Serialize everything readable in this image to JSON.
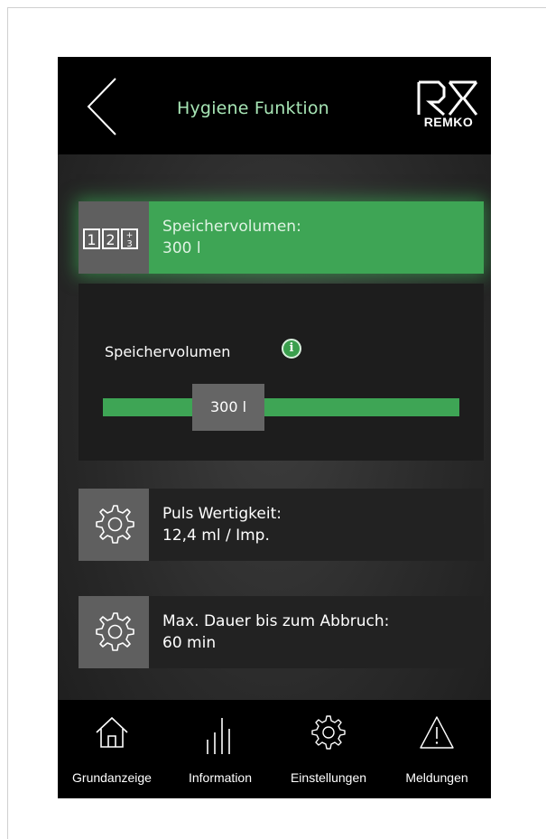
{
  "header": {
    "title": "Hygiene Funktion",
    "back_icon": "chevron-left-icon",
    "logo_text": "REMKO"
  },
  "cards": [
    {
      "label": "Speichervolumen:",
      "value": "300 l",
      "icon": "numeric-keypad-icon",
      "active": true
    },
    {
      "label": "Puls Wertigkeit:",
      "value": "12,4 ml / Imp.",
      "icon": "gear-icon",
      "active": false
    },
    {
      "label": "Max. Dauer bis zum Abbruch:",
      "value": "60 min",
      "icon": "gear-icon",
      "active": false
    }
  ],
  "slider": {
    "label": "Speichervolumen",
    "value": "300 l",
    "position_fraction": 0.31,
    "info_icon": "info-icon"
  },
  "nav": [
    {
      "label": "Grundanzeige",
      "icon": "home-icon"
    },
    {
      "label": "Information",
      "icon": "bars-icon"
    },
    {
      "label": "Einstellungen",
      "icon": "gear-icon"
    },
    {
      "label": "Meldungen",
      "icon": "warning-icon"
    }
  ],
  "colors": {
    "accent": "#3ea555",
    "title": "#a7e5b5",
    "header_bg": "#000000"
  }
}
